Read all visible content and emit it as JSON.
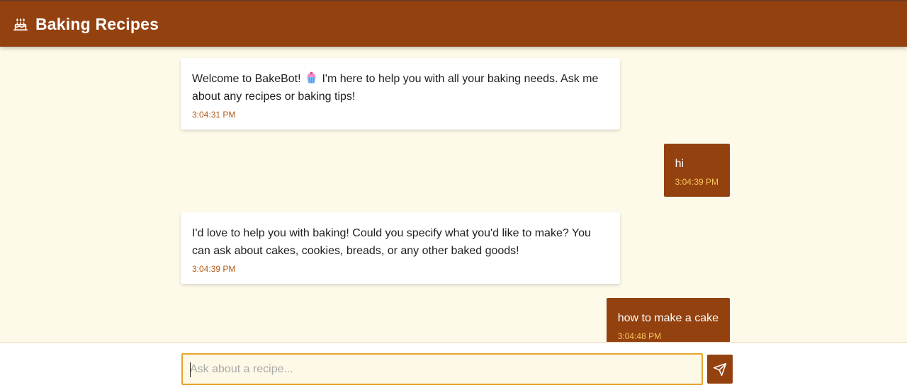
{
  "header": {
    "title": "Baking Recipes",
    "icon": "cake-icon"
  },
  "messages": [
    {
      "sender": "bot",
      "text_before": "Welcome to BakeBot!",
      "emoji": "cupcake-icon",
      "text_after": "I'm here to help you with all your baking needs. Ask me about any recipes or baking tips!",
      "time": "3:04:31 PM"
    },
    {
      "sender": "user",
      "text": "hi",
      "time": "3:04:39 PM"
    },
    {
      "sender": "bot",
      "text": "I'd love to help you with baking! Could you specify what you'd like to make? You can ask about cakes, cookies, breads, or any other baked goods!",
      "time": "3:04:39 PM"
    },
    {
      "sender": "user",
      "text": "how to make a cake",
      "time": "3:04:48 PM"
    }
  ],
  "composer": {
    "placeholder": "Ask about a recipe...",
    "value": "",
    "send_icon": "send-icon"
  },
  "colors": {
    "brand": "#944110",
    "background": "#fefae9",
    "bot_time": "#b35a18",
    "user_time": "#f6c75a",
    "input_border": "#e4a62e"
  }
}
